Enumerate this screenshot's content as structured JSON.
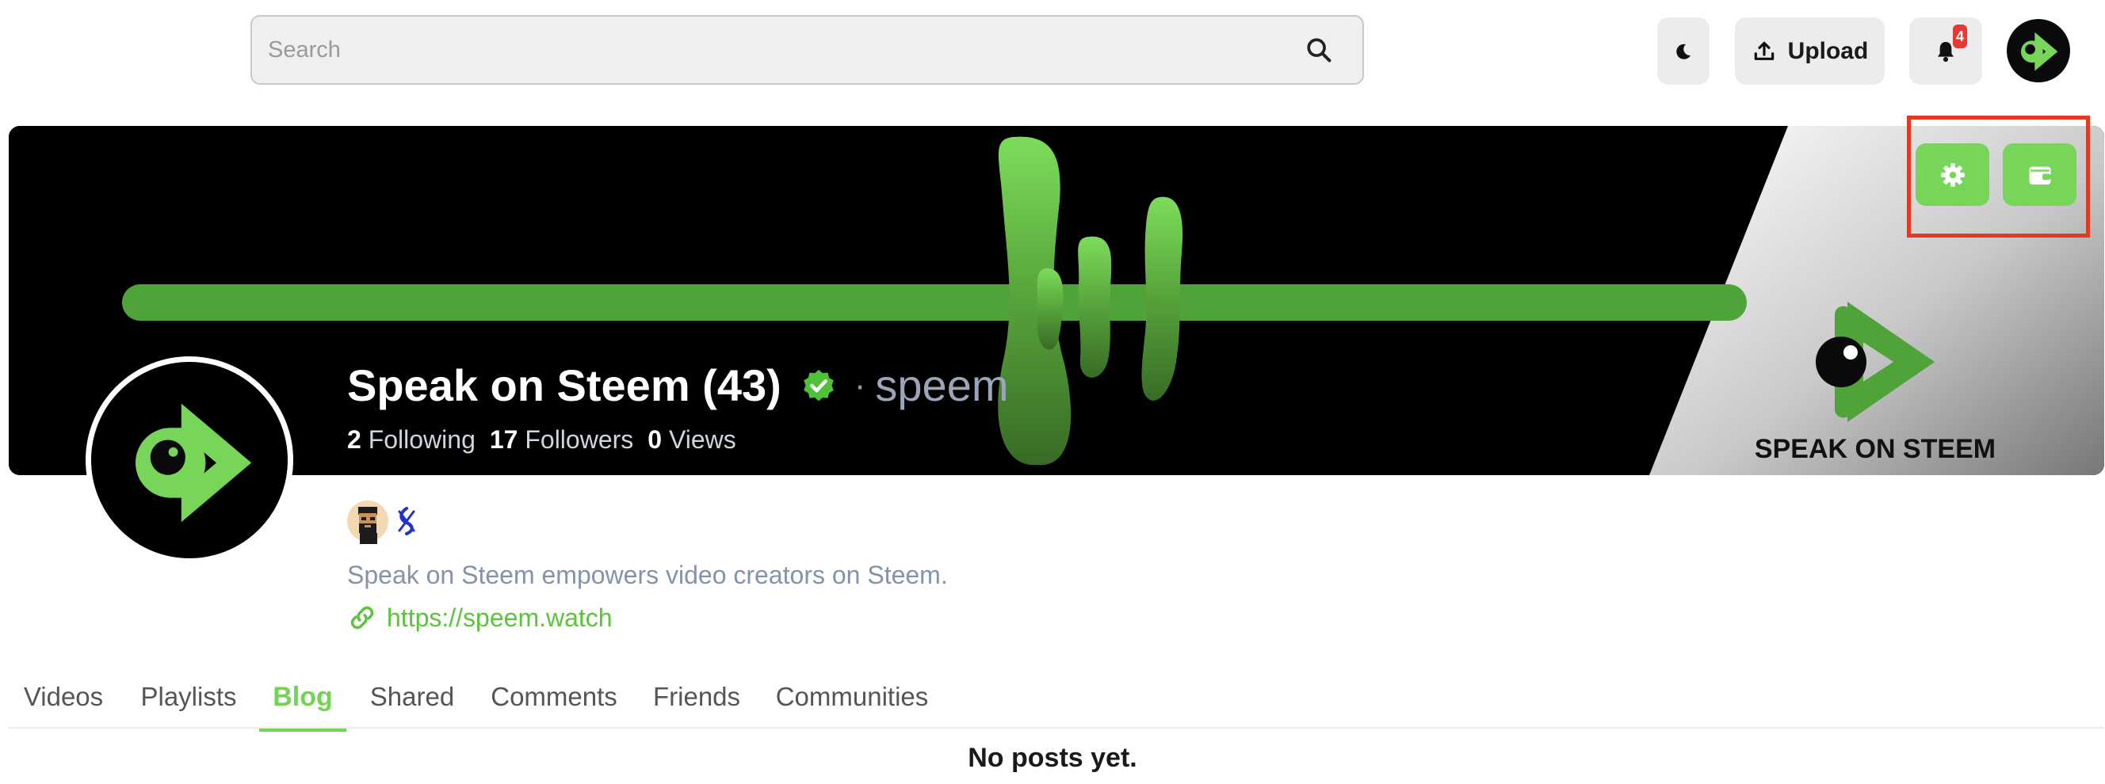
{
  "search": {
    "placeholder": "Search"
  },
  "header": {
    "upload_label": "Upload",
    "notification_count": "4",
    "icons": [
      "moon-icon",
      "upload-icon",
      "bell-icon",
      "user-avatar"
    ]
  },
  "banner": {
    "brand_text": "SPEAK ON STEEM"
  },
  "actions": {
    "icons": [
      "gear-icon",
      "wallet-icon"
    ]
  },
  "profile": {
    "name": "Speak on Steem (43)",
    "separator": "·",
    "username": "speem",
    "following_count": "2",
    "following_label": "Following",
    "followers_count": "17",
    "followers_label": "Followers",
    "views_count": "0",
    "views_label": "Views",
    "bio": "Speak on Steem empowers video creators on Steem.",
    "website": "https://speem.watch"
  },
  "tabs": [
    {
      "label": "Videos"
    },
    {
      "label": "Playlists"
    },
    {
      "label": "Blog",
      "active": true
    },
    {
      "label": "Shared"
    },
    {
      "label": "Comments"
    },
    {
      "label": "Friends"
    },
    {
      "label": "Communities"
    }
  ],
  "content": {
    "empty_message": "No posts yet."
  },
  "colors": {
    "accent_green": "#77d65a",
    "banner_black": "#000000",
    "highlight_red": "#e03a22",
    "badge_red": "#e53935"
  }
}
